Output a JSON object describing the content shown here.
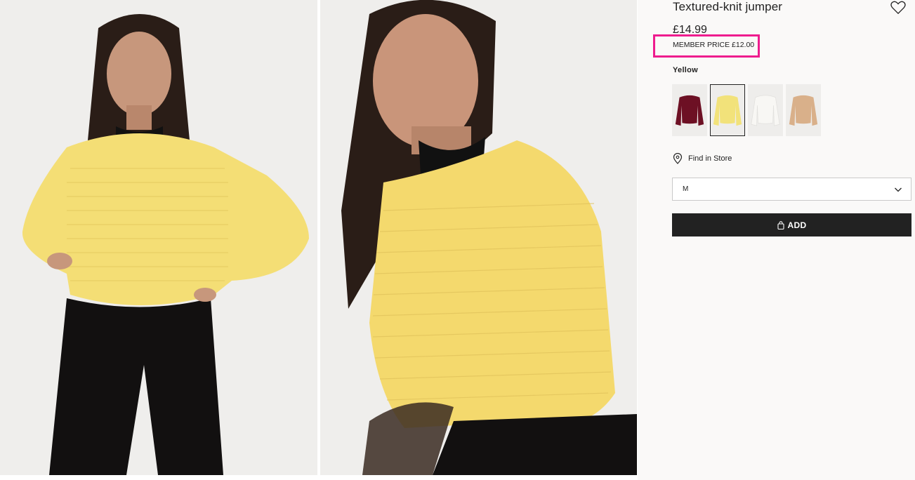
{
  "product": {
    "title": "Textured-knit jumper",
    "price": "£14.99",
    "member_price": "MEMBER PRICE £12.00",
    "color_label": "Yellow",
    "highlight_color": "#ee1c8e"
  },
  "swatches": [
    {
      "name": "burgundy",
      "color": "#6d1024",
      "selected": false
    },
    {
      "name": "yellow",
      "color": "#f2e27a",
      "selected": true
    },
    {
      "name": "white",
      "color": "#f4f3f0",
      "selected": false
    },
    {
      "name": "beige",
      "color": "#d9b08a",
      "selected": false
    }
  ],
  "store": {
    "label": "Find in Store",
    "icon": "location-pin-icon"
  },
  "size": {
    "selected": "M",
    "icon": "chevron-down-icon"
  },
  "cart": {
    "add_label": "ADD",
    "icon": "shopping-bag-icon"
  },
  "icons": {
    "favorite": "heart-icon"
  },
  "colors": {
    "button_bg": "#222222",
    "page_bg": "#faf9f8"
  }
}
